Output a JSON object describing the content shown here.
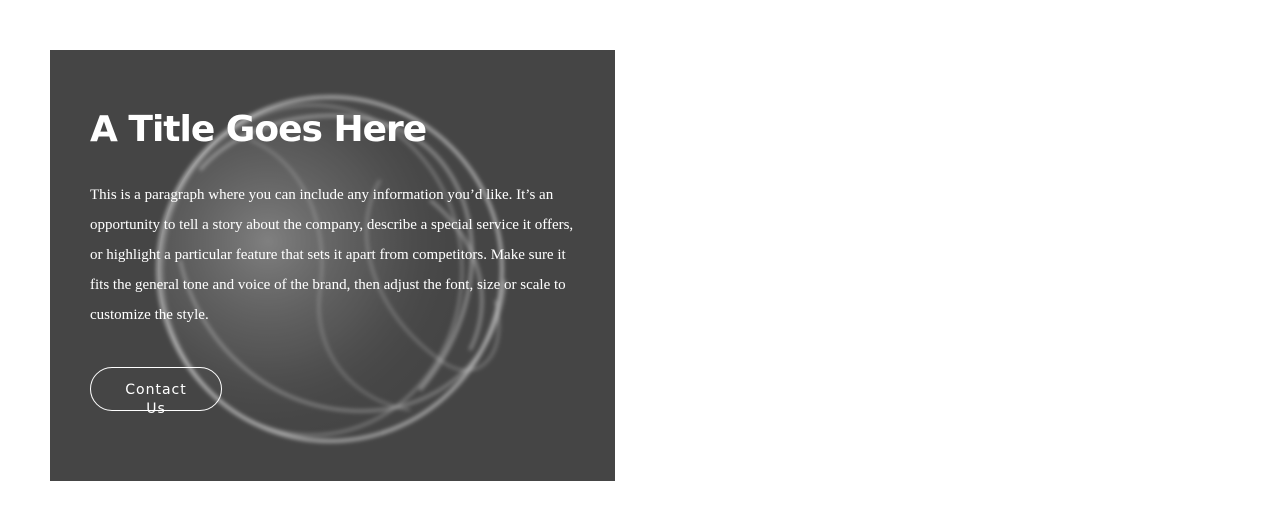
{
  "hero": {
    "title": "A Title Goes Here",
    "paragraph": "This is a paragraph where you can include any information you’d like. It’s an opportunity to tell a story about the company, describe a special service it offers, or highlight a particular feature that sets it apart from competitors. Make sure it fits the general tone and voice of the brand, then adjust the font, size or scale to customize the style.",
    "button_label": "Contact Us"
  },
  "colors": {
    "page_background": "#ffffff",
    "card_background": "#454545",
    "text": "#ffffff"
  }
}
